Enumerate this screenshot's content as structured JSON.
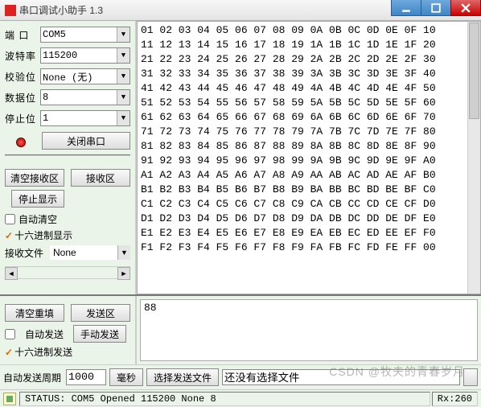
{
  "window": {
    "title": "串口调试小助手 1.3"
  },
  "config": {
    "port_label": "端  口",
    "port_value": "COM5",
    "baud_label": "波特率",
    "baud_value": "115200",
    "parity_label": "校验位",
    "parity_value": "None (无)",
    "databits_label": "数据位",
    "databits_value": "8",
    "stopbits_label": "停止位",
    "stopbits_value": "1",
    "close_port_btn": "关闭串口",
    "clear_recv_btn": "清空接收区",
    "recv_area_btn": "接收区",
    "stop_display_btn": "停止显示",
    "auto_clear_chk": "自动清空",
    "hex_display_chk": "十六进制显示",
    "recv_file_label": "接收文件",
    "recv_file_value": "None"
  },
  "recv_hex": "01 02 03 04 05 06 07 08 09 0A 0B 0C 0D 0E 0F 10\n11 12 13 14 15 16 17 18 19 1A 1B 1C 1D 1E 1F 20\n21 22 23 24 25 26 27 28 29 2A 2B 2C 2D 2E 2F 30\n31 32 33 34 35 36 37 38 39 3A 3B 3C 3D 3E 3F 40\n41 42 43 44 45 46 47 48 49 4A 4B 4C 4D 4E 4F 50\n51 52 53 54 55 56 57 58 59 5A 5B 5C 5D 5E 5F 60\n61 62 63 64 65 66 67 68 69 6A 6B 6C 6D 6E 6F 70\n71 72 73 74 75 76 77 78 79 7A 7B 7C 7D 7E 7F 80\n81 82 83 84 85 86 87 88 89 8A 8B 8C 8D 8E 8F 90\n91 92 93 94 95 96 97 98 99 9A 9B 9C 9D 9E 9F A0\nA1 A2 A3 A4 A5 A6 A7 A8 A9 AA AB AC AD AE AF B0\nB1 B2 B3 B4 B5 B6 B7 B8 B9 BA BB BC BD BE BF C0\nC1 C2 C3 C4 C5 C6 C7 C8 C9 CA CB CC CD CE CF D0\nD1 D2 D3 D4 D5 D6 D7 D8 D9 DA DB DC DD DE DF E0\nE1 E2 E3 E4 E5 E6 E7 E8 E9 EA EB EC ED EE EF F0\nF1 F2 F3 F4 F5 F6 F7 F8 F9 FA FB FC FD FE FF 00",
  "send": {
    "clear_resend_btn": "清空重填",
    "send_area_btn": "发送区",
    "auto_send_chk": "自动发送",
    "manual_send_btn": "手动发送",
    "hex_send_chk": "十六进制发送",
    "send_value": "88",
    "period_label": "自动发送周期",
    "period_value": "1000",
    "period_unit": "毫秒",
    "choose_file_btn": "选择发送文件",
    "no_file_text": "还没有选择文件"
  },
  "status": {
    "text": "STATUS: COM5 Opened 115200 None  8",
    "rx": "Rx:260"
  },
  "watermark": "CSDN @牧夫的青春岁月"
}
